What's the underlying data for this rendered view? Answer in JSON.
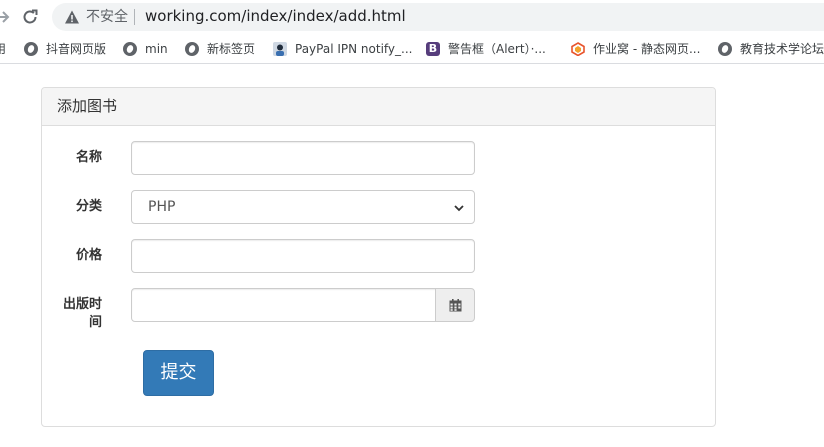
{
  "browser": {
    "security_label": "不安全",
    "url": "working.com/index/index/add.html"
  },
  "bookmarks": [
    {
      "label": "抖音网页版",
      "icon": "globe-icon"
    },
    {
      "label": "min",
      "icon": "globe-icon"
    },
    {
      "label": "新标签页",
      "icon": "globe-icon"
    },
    {
      "label": "PayPal IPN notify_...",
      "icon": "avatar-icon"
    },
    {
      "label": "警告框（Alert）·...",
      "icon": "bootstrap-icon",
      "icon_text": "B"
    },
    {
      "label": "作业窝 - 静态网页...",
      "icon": "site-logo-icon"
    },
    {
      "label": "教育技术学论坛",
      "icon": "globe-icon"
    }
  ],
  "form": {
    "title": "添加图书",
    "name_label": "名称",
    "name_value": "",
    "category_label": "分类",
    "category_selected": "PHP",
    "price_label": "价格",
    "price_value": "",
    "date_label_line1": "出版时",
    "date_label_line2": "间",
    "date_value": "",
    "submit_label": "提交"
  },
  "colors": {
    "primary": "#337ab7",
    "panel_heading_bg": "#f5f5f5",
    "border": "#dddddd",
    "bookstrap_purple": "#563d7c"
  }
}
